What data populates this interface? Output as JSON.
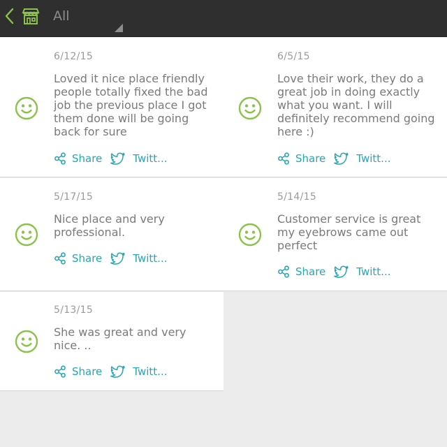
{
  "header": {
    "back_icon": "chevron-left-icon",
    "store_icon": "storefront-icon",
    "filter_value": "All",
    "accent_color": "#8bc34a"
  },
  "actions": {
    "share_label": "Share",
    "twitter_label": "Twitt..."
  },
  "reviews": [
    {
      "date": "6/12/15",
      "text": "Loved it nice place friendly people totally fixed the bad job the previous place I got them done will be going back for sure",
      "sentiment_icon": "smiley-face-icon"
    },
    {
      "date": "6/5/15",
      "text": "Love their work, they do a great job in doing exactly what you want. I will definitely recommend going here :)",
      "sentiment_icon": "smiley-face-icon"
    },
    {
      "date": "5/17/15",
      "text": "Nice place and very professional.",
      "sentiment_icon": "smiley-face-icon"
    },
    {
      "date": "5/14/15",
      "text": "Customer service is great my eyebrows came out perfect",
      "sentiment_icon": "smiley-face-icon"
    },
    {
      "date": "5/13/15",
      "text": "She was great and very nice. ..",
      "sentiment_icon": "smiley-face-icon"
    }
  ],
  "colors": {
    "smiley_green": "#8bc34a",
    "action_teal": "#27a6b8"
  }
}
